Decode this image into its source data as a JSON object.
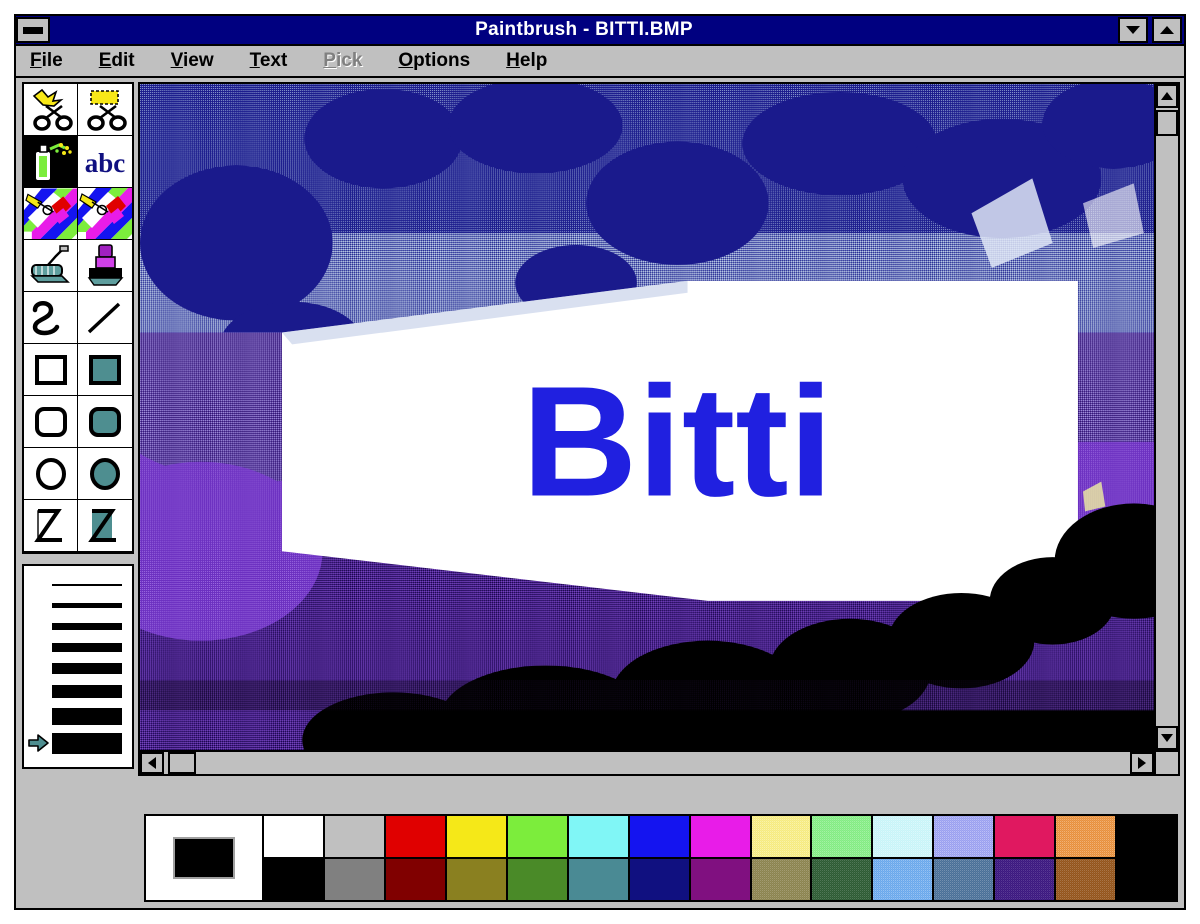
{
  "window": {
    "title": "Paintbrush - BITTI.BMP",
    "app_name": "Paintbrush",
    "file_name": "BITTI.BMP",
    "sysmenu_label": "System Menu",
    "minimize_label": "Minimize",
    "maximize_label": "Maximize",
    "titlebar_color": "#000080",
    "face_color": "#c0c0c0"
  },
  "menubar": {
    "items": [
      {
        "label": "File",
        "mnemonic": "F",
        "rest": "ile",
        "disabled": false
      },
      {
        "label": "Edit",
        "mnemonic": "E",
        "rest": "dit",
        "disabled": false
      },
      {
        "label": "View",
        "mnemonic": "V",
        "rest": "iew",
        "disabled": false
      },
      {
        "label": "Text",
        "mnemonic": "T",
        "rest": "ext",
        "disabled": false
      },
      {
        "label": "Pick",
        "mnemonic": "P",
        "rest": "ick",
        "disabled": true
      },
      {
        "label": "Options",
        "mnemonic": "O",
        "rest": "ptions",
        "disabled": false
      },
      {
        "label": "Help",
        "mnemonic": "H",
        "rest": "elp",
        "disabled": false
      }
    ]
  },
  "toolbox": {
    "tools": [
      {
        "name": "scissors-freeform-select-icon",
        "label": "Scissors (free-form cutout)",
        "selected": false
      },
      {
        "name": "scissors-rectangle-select-icon",
        "label": "Pick (rectangular cutout)",
        "selected": false
      },
      {
        "name": "airbrush-icon",
        "label": "Airbrush",
        "selected": true
      },
      {
        "name": "text-abc-icon",
        "label": "Text",
        "selected": false
      },
      {
        "name": "color-eraser-icon",
        "label": "Color Eraser",
        "selected": false
      },
      {
        "name": "eraser-icon",
        "label": "Eraser",
        "selected": false
      },
      {
        "name": "paint-roller-icon",
        "label": "Paint Roller (fill)",
        "selected": false
      },
      {
        "name": "paintbrush-icon",
        "label": "Brush",
        "selected": false
      },
      {
        "name": "curve-icon",
        "label": "Curve",
        "selected": false
      },
      {
        "name": "line-icon",
        "label": "Line",
        "selected": false
      },
      {
        "name": "rectangle-outline-icon",
        "label": "Box",
        "selected": false
      },
      {
        "name": "rectangle-filled-icon",
        "label": "Filled Box",
        "selected": false
      },
      {
        "name": "rounded-rectangle-outline-icon",
        "label": "Rounded Box",
        "selected": false
      },
      {
        "name": "rounded-rectangle-filled-icon",
        "label": "Filled Rounded Box",
        "selected": false
      },
      {
        "name": "ellipse-outline-icon",
        "label": "Circle/Ellipse",
        "selected": false
      },
      {
        "name": "ellipse-filled-icon",
        "label": "Filled Circle/Ellipse",
        "selected": false
      },
      {
        "name": "polygon-outline-icon",
        "label": "Polygon",
        "selected": false
      },
      {
        "name": "polygon-filled-icon",
        "label": "Filled Polygon",
        "selected": false
      }
    ]
  },
  "linewidth": {
    "label": "Line width",
    "selected_index": 7,
    "widths": [
      2,
      5,
      7,
      9,
      11,
      13,
      17,
      21
    ]
  },
  "canvas": {
    "artwork_text": "Bitti",
    "artwork_text_color": "#2020e0",
    "sky_color": "#1a1a8c",
    "mid_color": "#5b5bb0",
    "purple_color": "#6a2fb5",
    "dark_purple_color": "#3b1c6e",
    "banner_color": "#ffffff",
    "silhouette_color": "#000000"
  },
  "scrollbars": {
    "vertical": {
      "up_label": "Scroll up",
      "down_label": "Scroll down",
      "thumb_label": "Vertical scroll thumb"
    },
    "horizontal": {
      "left_label": "Scroll left",
      "right_label": "Scroll right",
      "thumb_label": "Horizontal scroll thumb"
    }
  },
  "palette": {
    "current_foreground": "#000000",
    "current_background": "#ffffff",
    "columns": [
      {
        "top": "#ffffff",
        "bottom": "#000000",
        "top_name": "white",
        "bottom_name": "black"
      },
      {
        "top": "#c0c0c0",
        "bottom": "#808080",
        "top_name": "light-gray",
        "bottom_name": "gray"
      },
      {
        "top": "#e00000",
        "bottom": "#800000",
        "top_name": "red",
        "bottom_name": "dark-red"
      },
      {
        "top": "#f5e818",
        "bottom": "#8a8020",
        "top_name": "yellow",
        "bottom_name": "olive"
      },
      {
        "top": "#7ced3c",
        "bottom": "#4a8a28",
        "top_name": "bright-green",
        "bottom_name": "green"
      },
      {
        "top": "#80f6f6",
        "bottom": "#4a8a94",
        "top_name": "cyan",
        "bottom_name": "teal"
      },
      {
        "top": "#1414f0",
        "bottom": "#101080",
        "top_name": "blue",
        "bottom_name": "navy"
      },
      {
        "top": "#e81ce8",
        "bottom": "#801080",
        "top_name": "magenta",
        "bottom_name": "purple"
      },
      {
        "top": "#f6eb80",
        "bottom": "#8c8450",
        "top_name": "pale-yellow",
        "bottom_name": "dark-khaki"
      },
      {
        "top": "#84ec84",
        "bottom": "#2e5c34",
        "top_name": "pale-green",
        "bottom_name": "dark-green"
      },
      {
        "top": "#c8f4f8",
        "bottom": "#6aa8ec",
        "top_name": "pale-cyan",
        "bottom_name": "light-blue"
      },
      {
        "top": "#9aa0f0",
        "bottom": "#4a7098",
        "top_name": "periwinkle",
        "bottom_name": "steel-blue"
      },
      {
        "top": "#e01860",
        "bottom": "#3c1880",
        "top_name": "pink-red",
        "bottom_name": "indigo"
      },
      {
        "top": "#e8903c",
        "bottom": "#94551c",
        "top_name": "orange",
        "bottom_name": "brown"
      },
      {
        "top": "#000000",
        "bottom": "#000000",
        "top_name": "black",
        "bottom_name": "black"
      }
    ]
  }
}
